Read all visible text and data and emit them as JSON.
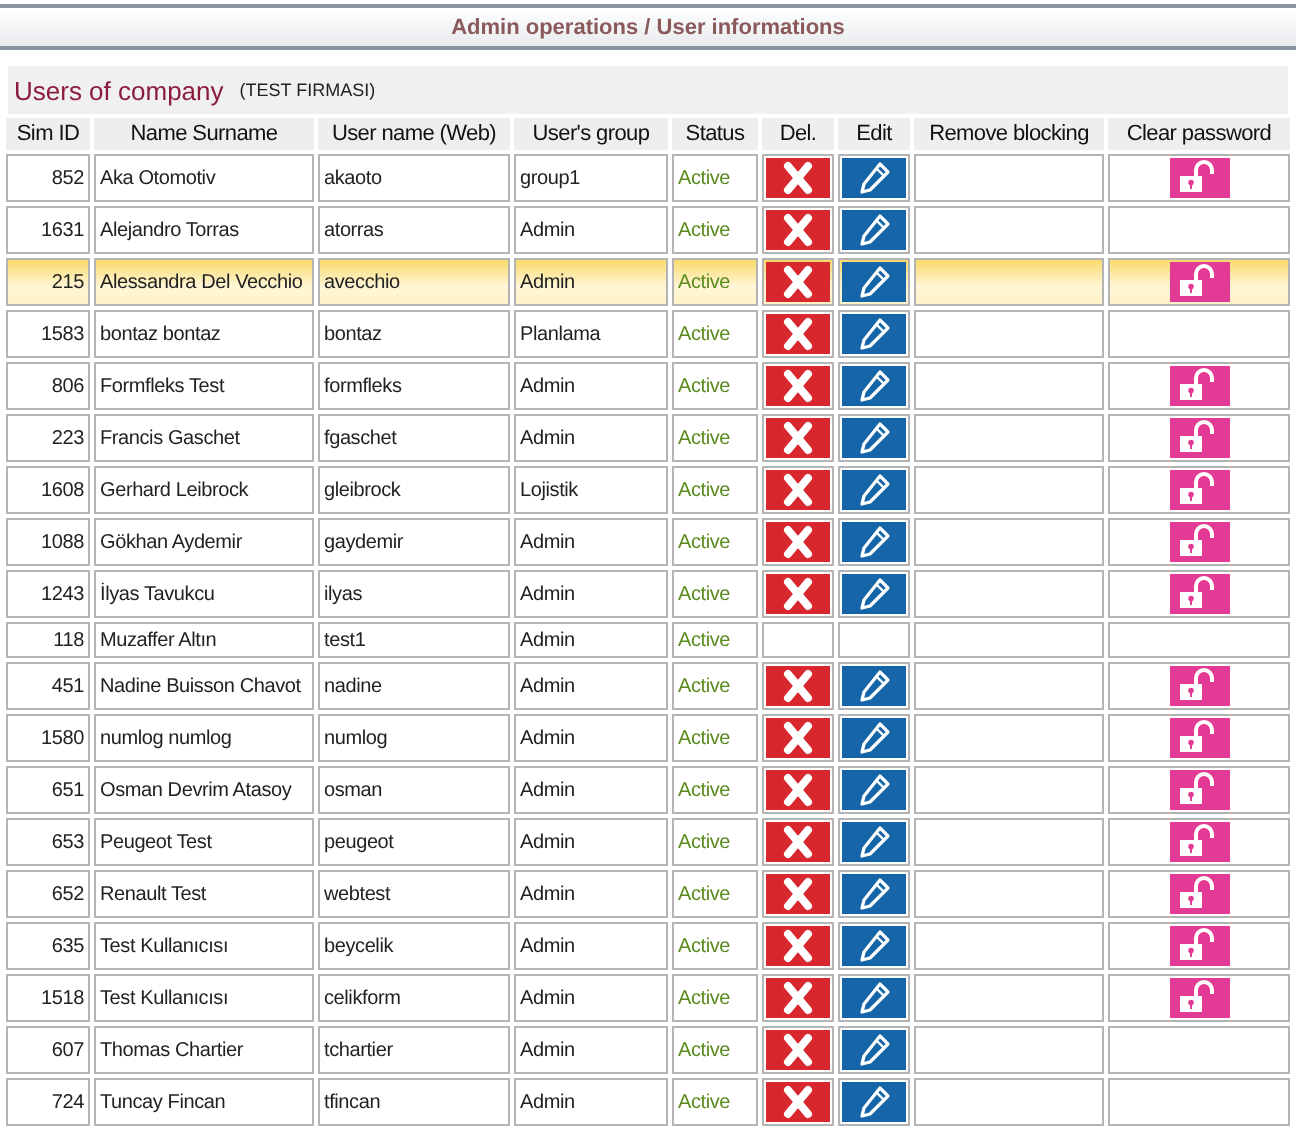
{
  "header": {
    "title": "Admin operations / User informations"
  },
  "section": {
    "title": "Users of company",
    "company": "(TEST FIRMASI)"
  },
  "table": {
    "columns": [
      "Sim ID",
      "Name Surname",
      "User name (Web)",
      "User's group",
      "Status",
      "Del.",
      "Edit",
      "Remove blocking",
      "Clear password"
    ],
    "rows": [
      {
        "id": "852",
        "name": "Aka Otomotiv",
        "username": "akaoto",
        "group": "group1",
        "status": "Active",
        "selected": false,
        "can_delete": true,
        "can_edit": true,
        "can_clear_password": true
      },
      {
        "id": "1631",
        "name": "Alejandro Torras",
        "username": "atorras",
        "group": "Admin",
        "status": "Active",
        "selected": false,
        "can_delete": true,
        "can_edit": true,
        "can_clear_password": false
      },
      {
        "id": "215",
        "name": "Alessandra Del Vecchio",
        "username": "avecchio",
        "group": "Admin",
        "status": "Active",
        "selected": true,
        "can_delete": true,
        "can_edit": true,
        "can_clear_password": true
      },
      {
        "id": "1583",
        "name": "bontaz bontaz",
        "username": "bontaz",
        "group": "Planlama",
        "status": "Active",
        "selected": false,
        "can_delete": true,
        "can_edit": true,
        "can_clear_password": false
      },
      {
        "id": "806",
        "name": "Formfleks Test",
        "username": "formfleks",
        "group": "Admin",
        "status": "Active",
        "selected": false,
        "can_delete": true,
        "can_edit": true,
        "can_clear_password": true
      },
      {
        "id": "223",
        "name": "Francis Gaschet",
        "username": "fgaschet",
        "group": "Admin",
        "status": "Active",
        "selected": false,
        "can_delete": true,
        "can_edit": true,
        "can_clear_password": true
      },
      {
        "id": "1608",
        "name": "Gerhard Leibrock",
        "username": "gleibrock",
        "group": "Lojistik",
        "status": "Active",
        "selected": false,
        "can_delete": true,
        "can_edit": true,
        "can_clear_password": true
      },
      {
        "id": "1088",
        "name": "Gökhan Aydemir",
        "username": "gaydemir",
        "group": "Admin",
        "status": "Active",
        "selected": false,
        "can_delete": true,
        "can_edit": true,
        "can_clear_password": true
      },
      {
        "id": "1243",
        "name": "İlyas Tavukcu",
        "username": "ilyas",
        "group": "Admin",
        "status": "Active",
        "selected": false,
        "can_delete": true,
        "can_edit": true,
        "can_clear_password": true
      },
      {
        "id": "118",
        "name": "Muzaffer Altın",
        "username": "test1",
        "group": "Admin",
        "status": "Active",
        "selected": false,
        "can_delete": false,
        "can_edit": false,
        "can_clear_password": false
      },
      {
        "id": "451",
        "name": "Nadine Buisson Chavot",
        "username": "nadine",
        "group": "Admin",
        "status": "Active",
        "selected": false,
        "can_delete": true,
        "can_edit": true,
        "can_clear_password": true
      },
      {
        "id": "1580",
        "name": "numlog numlog",
        "username": "numlog",
        "group": "Admin",
        "status": "Active",
        "selected": false,
        "can_delete": true,
        "can_edit": true,
        "can_clear_password": true
      },
      {
        "id": "651",
        "name": "Osman Devrim Atasoy",
        "username": "osman",
        "group": "Admin",
        "status": "Active",
        "selected": false,
        "can_delete": true,
        "can_edit": true,
        "can_clear_password": true
      },
      {
        "id": "653",
        "name": "Peugeot Test",
        "username": "peugeot",
        "group": "Admin",
        "status": "Active",
        "selected": false,
        "can_delete": true,
        "can_edit": true,
        "can_clear_password": true
      },
      {
        "id": "652",
        "name": "Renault Test",
        "username": "webtest",
        "group": "Admin",
        "status": "Active",
        "selected": false,
        "can_delete": true,
        "can_edit": true,
        "can_clear_password": true
      },
      {
        "id": "635",
        "name": "Test Kullanıcısı",
        "username": "beycelik",
        "group": "Admin",
        "status": "Active",
        "selected": false,
        "can_delete": true,
        "can_edit": true,
        "can_clear_password": true
      },
      {
        "id": "1518",
        "name": "Test Kullanıcısı",
        "username": "celikform",
        "group": "Admin",
        "status": "Active",
        "selected": false,
        "can_delete": true,
        "can_edit": true,
        "can_clear_password": true
      },
      {
        "id": "607",
        "name": "Thomas Chartier",
        "username": "tchartier",
        "group": "Admin",
        "status": "Active",
        "selected": false,
        "can_delete": true,
        "can_edit": true,
        "can_clear_password": false
      },
      {
        "id": "724",
        "name": "Tuncay Fincan",
        "username": "tfincan",
        "group": "Admin",
        "status": "Active",
        "selected": false,
        "can_delete": true,
        "can_edit": true,
        "can_clear_password": false
      }
    ]
  }
}
